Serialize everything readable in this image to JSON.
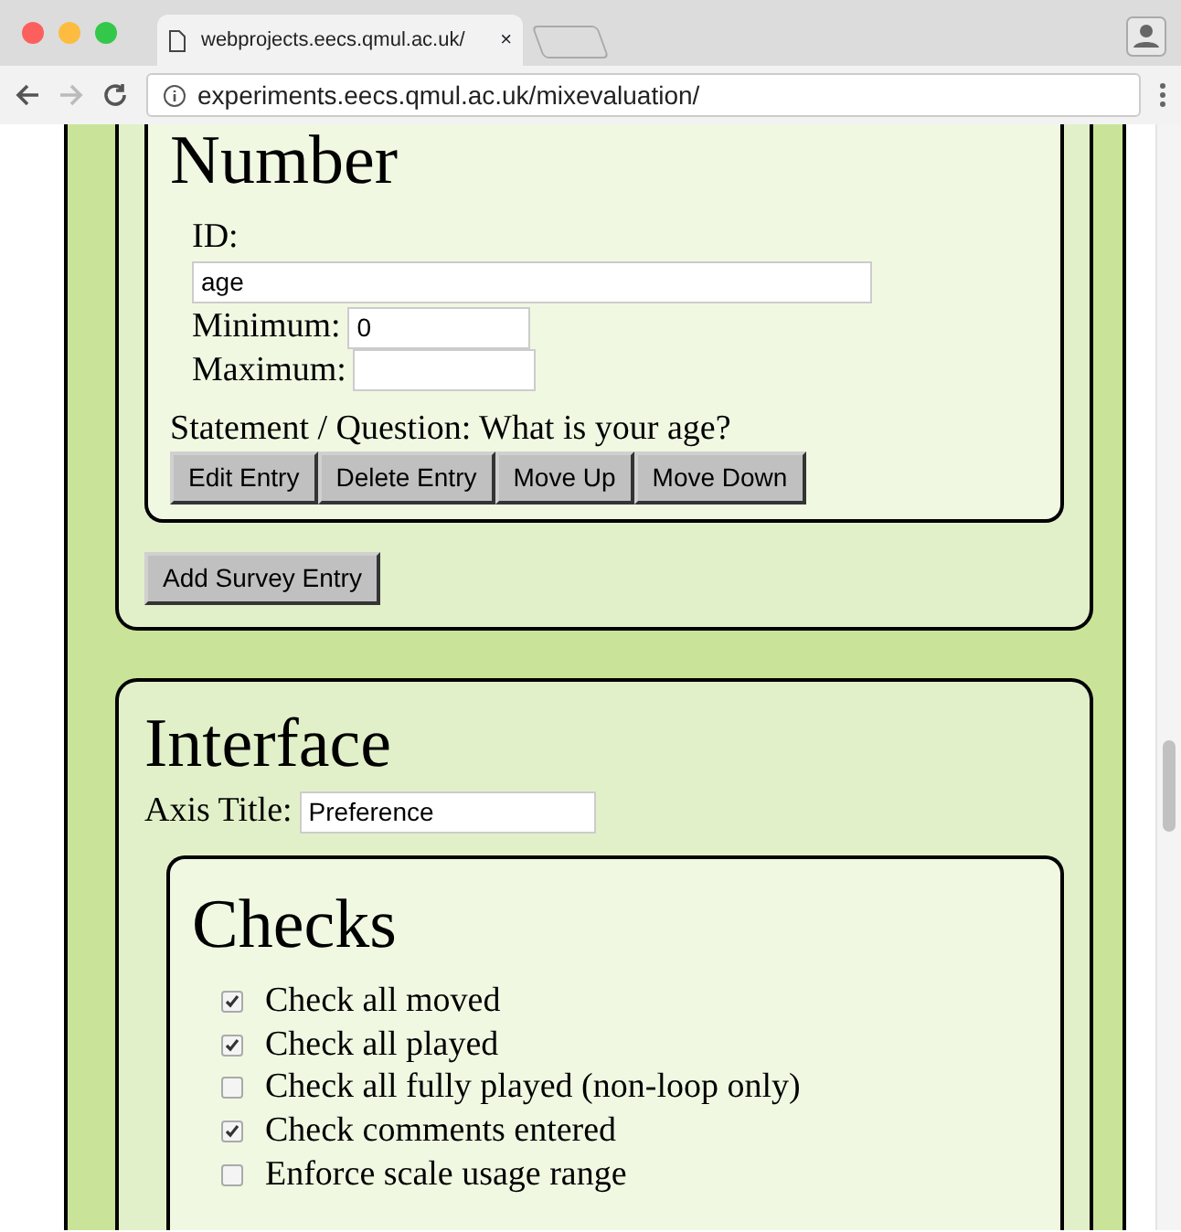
{
  "browser": {
    "tab_title": "webprojects.eecs.qmul.ac.uk/",
    "close_glyph": "×",
    "address": "experiments.eecs.qmul.ac.uk/mixevaluation/"
  },
  "survey_entry": {
    "title": "Number",
    "id_label": "ID:",
    "id_value": "age",
    "minimum_label": "Minimum:",
    "minimum_value": "0",
    "maximum_label": "Maximum:",
    "statement": "Statement / Question: What is your age?",
    "buttons": [
      "Edit Entry",
      "Delete Entry",
      "Move Up",
      "Move Down"
    ]
  },
  "add_button": "Add Survey Entry",
  "interface": {
    "title": "Interface",
    "axis_label": "Axis Title:",
    "axis_value": "Preference",
    "checks": {
      "title": "Checks",
      "items": [
        {
          "label": "Check all moved",
          "checked": true
        },
        {
          "label": "Check all played",
          "checked": true
        },
        {
          "label": "Check all fully played (non-loop only)",
          "checked": false
        },
        {
          "label": "Check comments entered",
          "checked": true
        },
        {
          "label": "Enforce scale usage range",
          "checked": false
        }
      ]
    }
  }
}
